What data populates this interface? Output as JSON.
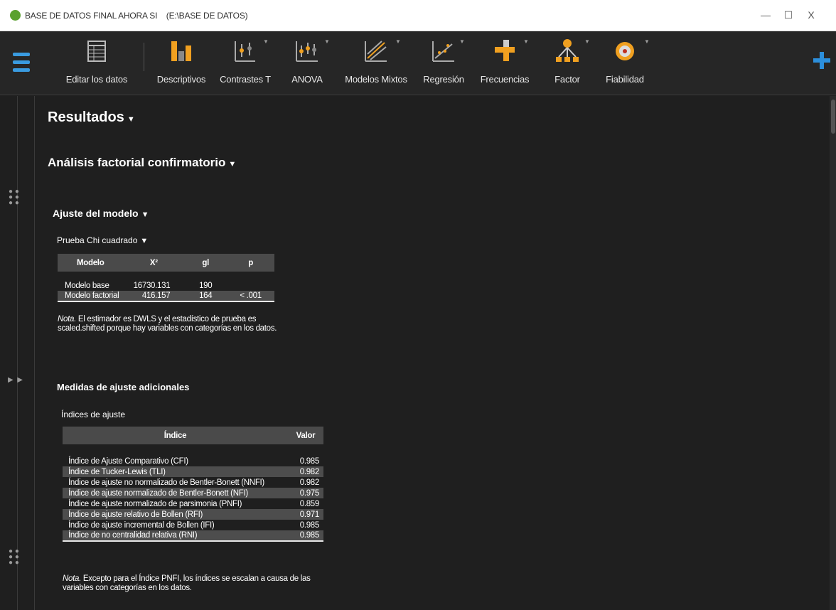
{
  "window": {
    "title": "BASE DE DATOS FINAL AHORA SI    (E:\\BASE DE DATOS)",
    "minimize": "—",
    "maximize": "☐",
    "close": "X"
  },
  "toolbar": {
    "items": [
      {
        "label": "Editar los datos",
        "icon": "table-icon"
      },
      {
        "label": "Descriptivos",
        "icon": "bar-chart-icon"
      },
      {
        "label": "Contrastes T",
        "icon": "t-test-icon"
      },
      {
        "label": "ANOVA",
        "icon": "anova-icon"
      },
      {
        "label": "Modelos Mixtos",
        "icon": "mixed-models-icon"
      },
      {
        "label": "Regresión",
        "icon": "regression-icon"
      },
      {
        "label": "Frecuencias",
        "icon": "frequencies-icon"
      },
      {
        "label": "Factor",
        "icon": "factor-icon"
      },
      {
        "label": "Fiabilidad",
        "icon": "reliability-icon"
      }
    ],
    "accent_color": "#2c8fdc"
  },
  "results": {
    "title": "Resultados",
    "section": "Análisis factorial confirmatorio",
    "model_fit": {
      "title": "Ajuste del modelo",
      "chi_title": "Prueba Chi cuadrado",
      "columns": [
        "Modelo",
        "X²",
        "gl",
        "p"
      ],
      "rows": [
        [
          "Modelo base",
          "16730.131",
          "190",
          ""
        ],
        [
          "Modelo factorial",
          "416.157",
          "164",
          "< .001"
        ]
      ],
      "note_label": "Nota.",
      "note": " El estimador es DWLS y el estadístico de prueba es scaled.shifted porque hay variables con categorías en los datos."
    },
    "additional": {
      "title": "Medidas de ajuste adicionales",
      "table_title": "Índices de ajuste",
      "columns": [
        "Índice",
        "Valor"
      ],
      "rows": [
        [
          "Índice de Ajuste Comparativo (CFI)",
          "0.985"
        ],
        [
          "Índice de Tucker-Lewis (TLI)",
          "0.982"
        ],
        [
          "Índice de ajuste no normalizado de Bentler-Bonett (NNFI)",
          "0.982"
        ],
        [
          "Índice de ajuste normalizado de Bentler-Bonett (NFI)",
          "0.975"
        ],
        [
          "Índice de ajuste normalizado de parsimonia (PNFI)",
          "0.859"
        ],
        [
          "Índice de ajuste relativo de Bollen (RFI)",
          "0.971"
        ],
        [
          "Índice de ajuste incremental de Bollen (IFI)",
          "0.985"
        ],
        [
          "Índice de no centralidad relativa (RNI)",
          "0.985"
        ]
      ],
      "note_label": "Nota.",
      "note": " Excepto para el Índice PNFI, los índices se escalan a causa de las variables con categorías en los datos."
    }
  }
}
